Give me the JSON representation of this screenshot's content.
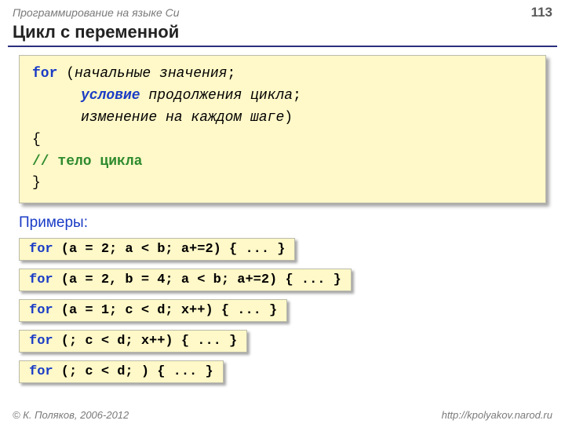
{
  "header": {
    "course": "Программирование на языке Си",
    "page": "113"
  },
  "title": "Цикл с переменной",
  "syntax": {
    "for": "for",
    "open": " (",
    "init": "начальные значения",
    "semi1": ";",
    "cond": "условие",
    "cond_rest": " продолжения цикла",
    "semi2": ";",
    "step": "изменение на каждом шаге",
    "close": ")",
    "brace_open": "{",
    "comment": "// тело цикла",
    "brace_close": "}"
  },
  "examples_label": "Примеры:",
  "examples": [
    {
      "for": "for",
      "rest": " (a = 2; a < b; a+=2) { ... }"
    },
    {
      "for": "for",
      "rest": " (a = 2, b = 4; a < b; a+=2) { ... }"
    },
    {
      "for": "for",
      "rest": " (a = 1; c < d; x++) { ... }"
    },
    {
      "for": "for",
      "rest": " (; c < d; x++) { ... }"
    },
    {
      "for": "for",
      "rest": " (; c < d; ) { ... }"
    }
  ],
  "footer": {
    "copyright": "© К. Поляков, 2006-2012",
    "url": "http://kpolyakov.narod.ru"
  }
}
